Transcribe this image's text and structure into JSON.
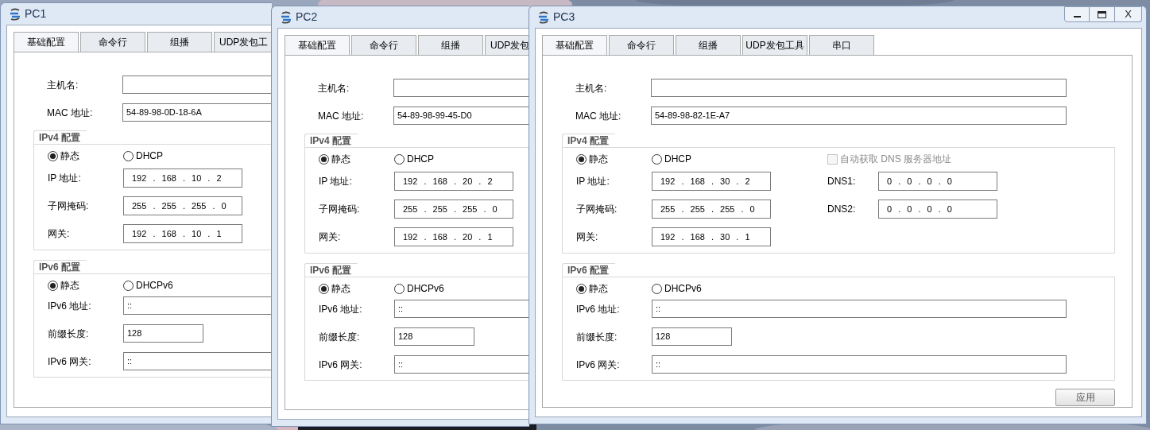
{
  "windows": [
    {
      "title": "PC1",
      "tabs": [
        {
          "label": "基础配置",
          "selected": true
        },
        {
          "label": "命令行",
          "selected": false
        },
        {
          "label": "组播",
          "selected": false
        },
        {
          "label": "UDP发包工",
          "selected": false
        }
      ],
      "basic": [
        {
          "label": "主机名:"
        },
        {
          "label": "MAC 地址:",
          "value": "54-89-98-0D-18-6A"
        }
      ],
      "ipv4": {
        "title": "IPv4 配置",
        "modes": [
          {
            "label": "静态",
            "selected": true
          },
          {
            "label": "DHCP",
            "selected": false
          }
        ],
        "fields": [
          {
            "label": "IP 地址:",
            "value": "192 . 168 . 10 . 2"
          },
          {
            "label": "子网掩码:",
            "value": "255 . 255 . 255 . 0"
          },
          {
            "label": "网关:",
            "value": "192 . 168 . 10 . 1"
          }
        ]
      },
      "ipv6": {
        "title": "IPv6 配置",
        "modes": [
          {
            "label": "静态",
            "selected": true
          },
          {
            "label": "DHCPv6",
            "selected": false
          }
        ],
        "fields": [
          {
            "label": "IPv6 地址:",
            "value": "::",
            "kind": "wide"
          },
          {
            "label": "前缀长度:",
            "value": "128",
            "kind": "short"
          },
          {
            "label": "IPv6 网关:",
            "value": "::",
            "kind": "wide"
          }
        ]
      }
    },
    {
      "title": "PC2",
      "tabs": [
        {
          "label": "基础配置",
          "selected": true
        },
        {
          "label": "命令行",
          "selected": false
        },
        {
          "label": "组播",
          "selected": false
        },
        {
          "label": "UDP发包",
          "selected": false
        }
      ],
      "basic": [
        {
          "label": "主机名:"
        },
        {
          "label": "MAC 地址:",
          "value": "54-89-98-99-45-D0"
        }
      ],
      "ipv4": {
        "title": "IPv4 配置",
        "modes": [
          {
            "label": "静态",
            "selected": true
          },
          {
            "label": "DHCP",
            "selected": false
          }
        ],
        "fields": [
          {
            "label": "IP 地址:",
            "value": "192 . 168 . 20 . 2"
          },
          {
            "label": "子网掩码:",
            "value": "255 . 255 . 255 . 0"
          },
          {
            "label": "网关:",
            "value": "192 . 168 . 20 . 1"
          }
        ]
      },
      "ipv6": {
        "title": "IPv6 配置",
        "modes": [
          {
            "label": "静态",
            "selected": true
          },
          {
            "label": "DHCPv6",
            "selected": false
          }
        ],
        "fields": [
          {
            "label": "IPv6 地址:",
            "value": "::",
            "kind": "wide"
          },
          {
            "label": "前缀长度:",
            "value": "128",
            "kind": "short"
          },
          {
            "label": "IPv6 网关:",
            "value": "::",
            "kind": "wide"
          }
        ]
      }
    },
    {
      "title": "PC3",
      "close_label": "X",
      "tabs": [
        {
          "label": "基础配置",
          "selected": true
        },
        {
          "label": "命令行",
          "selected": false
        },
        {
          "label": "组播",
          "selected": false
        },
        {
          "label": "UDP发包工具",
          "selected": false
        },
        {
          "label": "串口",
          "selected": false
        }
      ],
      "basic": [
        {
          "label": "主机名:"
        },
        {
          "label": "MAC 地址:",
          "value": "54-89-98-82-1E-A7"
        }
      ],
      "ipv4": {
        "title": "IPv4 配置",
        "modes": [
          {
            "label": "静态",
            "selected": true
          },
          {
            "label": "DHCP",
            "selected": false
          }
        ],
        "fields": [
          {
            "label": "IP 地址:",
            "value": "192 . 168 . 30 . 2"
          },
          {
            "label": "子网掩码:",
            "value": "255 . 255 . 255 . 0"
          },
          {
            "label": "网关:",
            "value": "192 . 168 . 30 . 1"
          }
        ],
        "dns_auto": {
          "label": "自动获取 DNS 服务器地址",
          "checked": false,
          "disabled": true
        },
        "dns": [
          {
            "label": "DNS1:",
            "value": "0 . 0 . 0 . 0"
          },
          {
            "label": "DNS2:",
            "value": "0 . 0 . 0 . 0"
          }
        ]
      },
      "ipv6": {
        "title": "IPv6 配置",
        "modes": [
          {
            "label": "静态",
            "selected": true
          },
          {
            "label": "DHCPv6",
            "selected": false
          }
        ],
        "fields": [
          {
            "label": "IPv6 地址:",
            "value": "::",
            "kind": "wide"
          },
          {
            "label": "前缀长度:",
            "value": "128",
            "kind": "short"
          },
          {
            "label": "IPv6 网关:",
            "value": "::",
            "kind": "wide"
          }
        ]
      },
      "apply": "应用"
    }
  ]
}
